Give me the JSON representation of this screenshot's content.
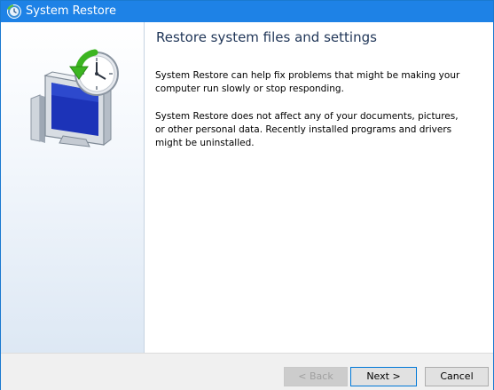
{
  "window": {
    "title": "System Restore"
  },
  "content": {
    "heading": "Restore system files and settings",
    "paragraphs": [
      "System Restore can help fix problems that might be making your computer run slowly or stop responding.",
      "System Restore does not affect any of your documents, pictures, or other personal data. Recently installed programs and drivers might be uninstalled."
    ]
  },
  "buttons": {
    "back": "< Back",
    "next": "Next >",
    "cancel": "Cancel"
  },
  "icons": {
    "title": "system-restore-icon",
    "hero": "system-restore-clock-monitor-icon"
  },
  "colors": {
    "titlebar": "#1e82e6",
    "heading": "#1f3557",
    "default_button_border": "#0078d7"
  }
}
